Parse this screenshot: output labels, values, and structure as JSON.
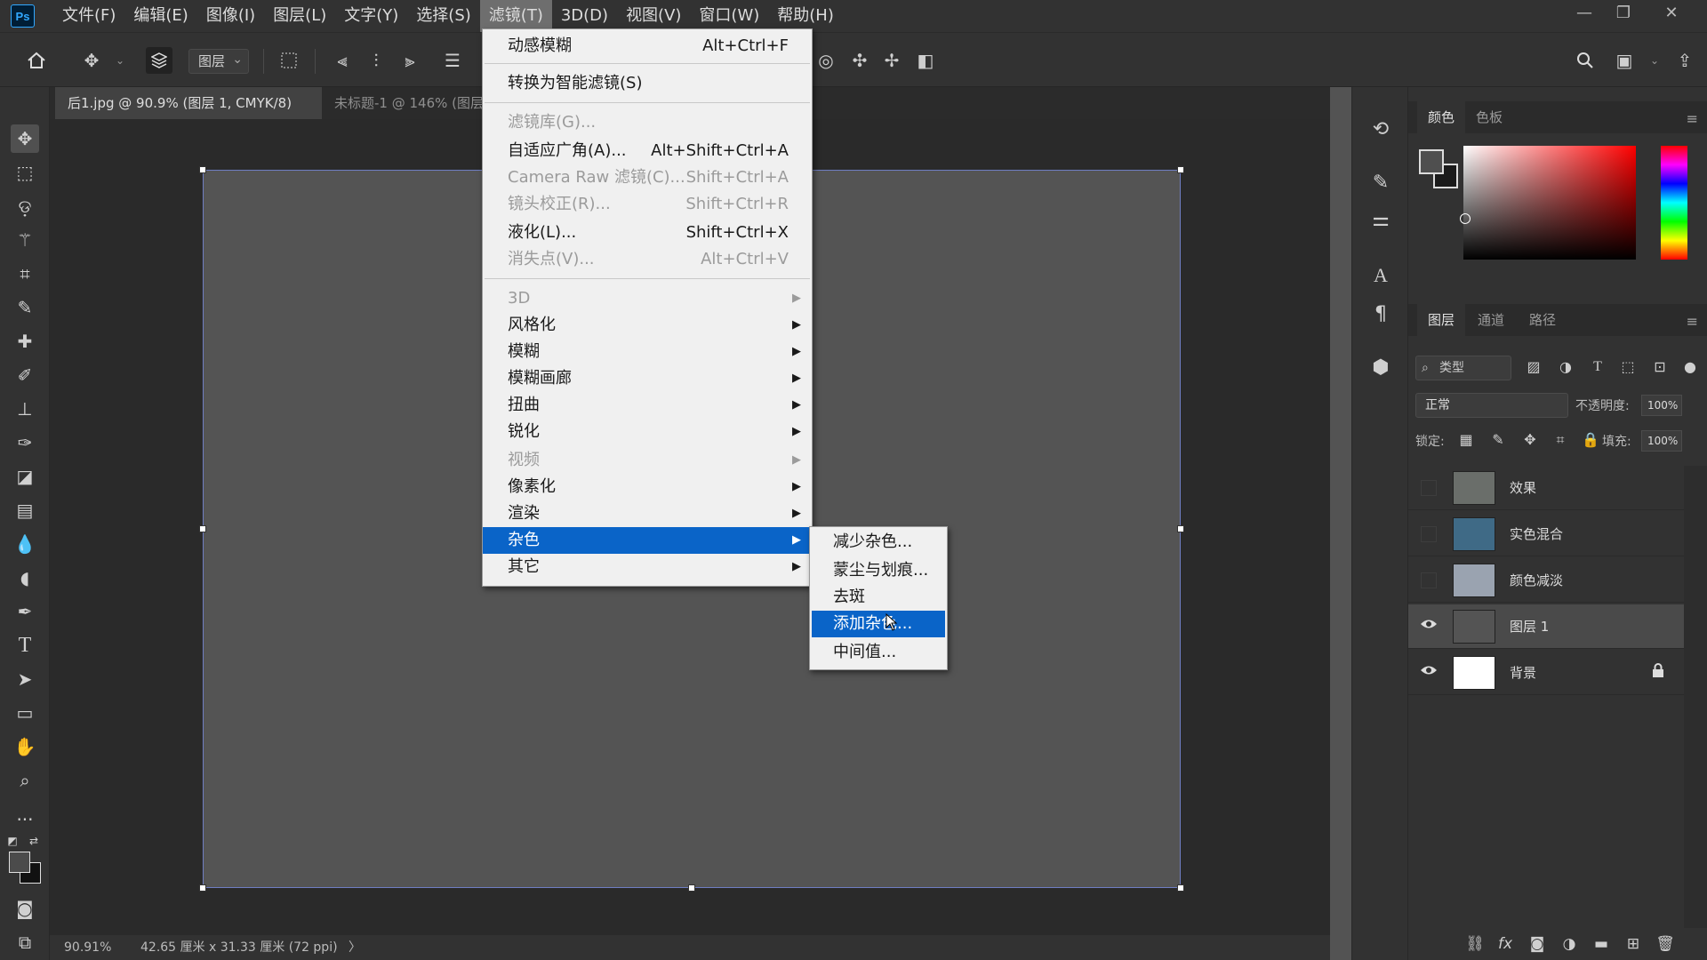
{
  "app": {
    "logo": "Ps"
  },
  "menubar": {
    "items": [
      "文件(F)",
      "编辑(E)",
      "图像(I)",
      "图层(L)",
      "文字(Y)",
      "选择(S)",
      "滤镜(T)",
      "3D(D)",
      "视图(V)",
      "窗口(W)",
      "帮助(H)"
    ],
    "active": "滤镜(T)"
  },
  "window_controls": {
    "minimize": "—",
    "restore": "❐",
    "close": "✕"
  },
  "options_bar": {
    "layer_select": "图层"
  },
  "tabs": [
    {
      "label": "后1.jpg @ 90.9% (图层 1, CMYK/8) *",
      "close": "×"
    },
    {
      "label": "未标题-1 @ 146% (图层"
    }
  ],
  "status": {
    "zoom": "90.91%",
    "doc_info": "42.65 厘米 x 31.33 厘米 (72 ppi)",
    "arrow": "〉"
  },
  "color_panel": {
    "tabs": [
      "颜色",
      "色板"
    ]
  },
  "layers_panel": {
    "tabs": [
      "图层",
      "通道",
      "路径"
    ],
    "search_placeholder": "类型",
    "blend_mode": "正常",
    "opacity_label": "不透明度:",
    "opacity_value": "100%",
    "lock_label": "锁定:",
    "fill_label": "填充:",
    "fill_value": "100%",
    "layers": [
      {
        "name": "效果",
        "visible": false,
        "selected": false,
        "thumb_color": "#6a6e6a"
      },
      {
        "name": "实色混合",
        "visible": false,
        "selected": false,
        "thumb_color": "#3f6a86"
      },
      {
        "name": "颜色减淡",
        "visible": false,
        "selected": false,
        "thumb_color": "#9aa3b0"
      },
      {
        "name": "图层 1",
        "visible": true,
        "selected": true,
        "thumb_color": "#545454"
      },
      {
        "name": "背景",
        "visible": true,
        "selected": false,
        "thumb_color": "#ffffff",
        "locked": true
      }
    ]
  },
  "filter_menu": {
    "items": [
      {
        "label": "动感模糊",
        "shortcut": "Alt+Ctrl+F"
      },
      {
        "label": "转换为智能滤镜(S)",
        "shortcut": ""
      },
      {
        "label": "滤镜库(G)...",
        "shortcut": "",
        "disabled": true
      },
      {
        "label": "自适应广角(A)...",
        "shortcut": "Alt+Shift+Ctrl+A"
      },
      {
        "label": "Camera Raw 滤镜(C)...",
        "shortcut": "Shift+Ctrl+A",
        "disabled": true
      },
      {
        "label": "镜头校正(R)...",
        "shortcut": "Shift+Ctrl+R",
        "disabled": true
      },
      {
        "label": "液化(L)...",
        "shortcut": "Shift+Ctrl+X"
      },
      {
        "label": "消失点(V)...",
        "shortcut": "Alt+Ctrl+V",
        "disabled": true
      },
      {
        "label": "3D",
        "submenu": true,
        "disabled": true
      },
      {
        "label": "风格化",
        "submenu": true
      },
      {
        "label": "模糊",
        "submenu": true
      },
      {
        "label": "模糊画廊",
        "submenu": true
      },
      {
        "label": "扭曲",
        "submenu": true
      },
      {
        "label": "锐化",
        "submenu": true
      },
      {
        "label": "视频",
        "submenu": true,
        "disabled": true
      },
      {
        "label": "像素化",
        "submenu": true
      },
      {
        "label": "渲染",
        "submenu": true
      },
      {
        "label": "杂色",
        "submenu": true,
        "highlighted": true
      },
      {
        "label": "其它",
        "submenu": true
      }
    ],
    "arrow": "▶"
  },
  "noise_submenu": {
    "items": [
      {
        "label": "减少杂色..."
      },
      {
        "label": "蒙尘与划痕..."
      },
      {
        "label": "去斑"
      },
      {
        "label": "添加杂色...",
        "highlighted": true
      },
      {
        "label": "中间值..."
      }
    ]
  }
}
